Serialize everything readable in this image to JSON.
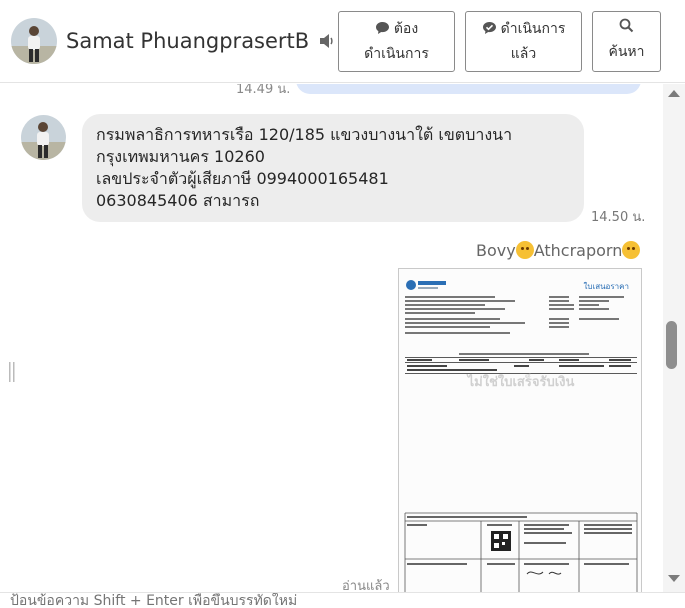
{
  "header": {
    "contact_name": "Samat PhuangprasertB",
    "buttons": {
      "todo_line1": "ต้อง",
      "todo_line2": "ดำเนินการ",
      "done_line1": "ดำเนินการ",
      "done_line2": "แล้ว",
      "search": "ค้นหา"
    }
  },
  "chat": {
    "previous_time": "14.49 น.",
    "message": {
      "lines": [
        "กรมพลาธิการทหารเรือ 120/185 แขวงบางนาใต้ เขตบางนา",
        "กรุงเทพมหานคร 10260",
        "เลขประจำตัวผู้เสียภาษี 0994000165481",
        "0630845406 สามารถ"
      ],
      "time": "14.50 น."
    },
    "reply": {
      "sender_part1": "Bovy",
      "sender_part2": "Athcraporn",
      "image_header_right": "ใบเสนอราคา",
      "image_watermark": "ไม่ใช่ใบเสร็จรับเงิน",
      "status": "อ่านแล้ว"
    }
  },
  "composer": {
    "placeholder": "ป้อนข้อความ Shift + Enter เพื่อขึ้นบรรทัดใหม่"
  },
  "icons": {
    "speaker": "speaker-icon",
    "todo": "chat-bubble-icon",
    "done": "check-bubble-icon",
    "search": "search-icon"
  },
  "colors": {
    "bubble_incoming": "#ededed",
    "bubble_outgoing": "#dbe6fa"
  }
}
